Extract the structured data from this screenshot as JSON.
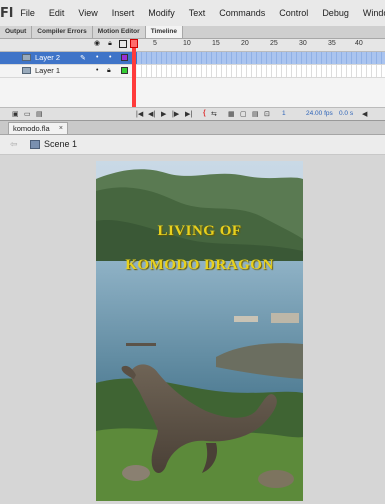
{
  "app": {
    "logo": "Fl"
  },
  "menu": [
    "File",
    "Edit",
    "View",
    "Insert",
    "Modify",
    "Text",
    "Commands",
    "Control",
    "Debug",
    "Window"
  ],
  "panel_tabs": [
    "Output",
    "Compiler Errors",
    "Motion Editor",
    "Timeline"
  ],
  "timeline": {
    "ruler": [
      "1",
      "5",
      "10",
      "15",
      "20",
      "25",
      "30",
      "35",
      "40"
    ],
    "layers": [
      {
        "name": "Layer 2",
        "selected": true,
        "color": "#9b2fd3"
      },
      {
        "name": "Layer 1",
        "selected": false,
        "color": "#33cc33"
      }
    ],
    "current_frame": "1",
    "fps": "24.00 fps",
    "elapsed": "0.0 s"
  },
  "document": {
    "tab": "komodo.fla",
    "close": "×"
  },
  "scene": {
    "label": "Scene 1"
  },
  "stage": {
    "title_line1": "LIVING OF",
    "title_line2": "KOMODO DRAGON"
  }
}
